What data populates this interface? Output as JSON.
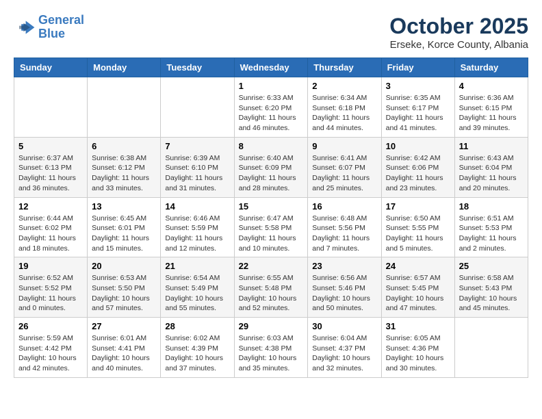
{
  "logo": {
    "line1": "General",
    "line2": "Blue"
  },
  "title": "October 2025",
  "subtitle": "Erseke, Korce County, Albania",
  "weekdays": [
    "Sunday",
    "Monday",
    "Tuesday",
    "Wednesday",
    "Thursday",
    "Friday",
    "Saturday"
  ],
  "weeks": [
    [
      {
        "day": "",
        "info": ""
      },
      {
        "day": "",
        "info": ""
      },
      {
        "day": "",
        "info": ""
      },
      {
        "day": "1",
        "info": "Sunrise: 6:33 AM\nSunset: 6:20 PM\nDaylight: 11 hours and 46 minutes."
      },
      {
        "day": "2",
        "info": "Sunrise: 6:34 AM\nSunset: 6:18 PM\nDaylight: 11 hours and 44 minutes."
      },
      {
        "day": "3",
        "info": "Sunrise: 6:35 AM\nSunset: 6:17 PM\nDaylight: 11 hours and 41 minutes."
      },
      {
        "day": "4",
        "info": "Sunrise: 6:36 AM\nSunset: 6:15 PM\nDaylight: 11 hours and 39 minutes."
      }
    ],
    [
      {
        "day": "5",
        "info": "Sunrise: 6:37 AM\nSunset: 6:13 PM\nDaylight: 11 hours and 36 minutes."
      },
      {
        "day": "6",
        "info": "Sunrise: 6:38 AM\nSunset: 6:12 PM\nDaylight: 11 hours and 33 minutes."
      },
      {
        "day": "7",
        "info": "Sunrise: 6:39 AM\nSunset: 6:10 PM\nDaylight: 11 hours and 31 minutes."
      },
      {
        "day": "8",
        "info": "Sunrise: 6:40 AM\nSunset: 6:09 PM\nDaylight: 11 hours and 28 minutes."
      },
      {
        "day": "9",
        "info": "Sunrise: 6:41 AM\nSunset: 6:07 PM\nDaylight: 11 hours and 25 minutes."
      },
      {
        "day": "10",
        "info": "Sunrise: 6:42 AM\nSunset: 6:06 PM\nDaylight: 11 hours and 23 minutes."
      },
      {
        "day": "11",
        "info": "Sunrise: 6:43 AM\nSunset: 6:04 PM\nDaylight: 11 hours and 20 minutes."
      }
    ],
    [
      {
        "day": "12",
        "info": "Sunrise: 6:44 AM\nSunset: 6:02 PM\nDaylight: 11 hours and 18 minutes."
      },
      {
        "day": "13",
        "info": "Sunrise: 6:45 AM\nSunset: 6:01 PM\nDaylight: 11 hours and 15 minutes."
      },
      {
        "day": "14",
        "info": "Sunrise: 6:46 AM\nSunset: 5:59 PM\nDaylight: 11 hours and 12 minutes."
      },
      {
        "day": "15",
        "info": "Sunrise: 6:47 AM\nSunset: 5:58 PM\nDaylight: 11 hours and 10 minutes."
      },
      {
        "day": "16",
        "info": "Sunrise: 6:48 AM\nSunset: 5:56 PM\nDaylight: 11 hours and 7 minutes."
      },
      {
        "day": "17",
        "info": "Sunrise: 6:50 AM\nSunset: 5:55 PM\nDaylight: 11 hours and 5 minutes."
      },
      {
        "day": "18",
        "info": "Sunrise: 6:51 AM\nSunset: 5:53 PM\nDaylight: 11 hours and 2 minutes."
      }
    ],
    [
      {
        "day": "19",
        "info": "Sunrise: 6:52 AM\nSunset: 5:52 PM\nDaylight: 11 hours and 0 minutes."
      },
      {
        "day": "20",
        "info": "Sunrise: 6:53 AM\nSunset: 5:50 PM\nDaylight: 10 hours and 57 minutes."
      },
      {
        "day": "21",
        "info": "Sunrise: 6:54 AM\nSunset: 5:49 PM\nDaylight: 10 hours and 55 minutes."
      },
      {
        "day": "22",
        "info": "Sunrise: 6:55 AM\nSunset: 5:48 PM\nDaylight: 10 hours and 52 minutes."
      },
      {
        "day": "23",
        "info": "Sunrise: 6:56 AM\nSunset: 5:46 PM\nDaylight: 10 hours and 50 minutes."
      },
      {
        "day": "24",
        "info": "Sunrise: 6:57 AM\nSunset: 5:45 PM\nDaylight: 10 hours and 47 minutes."
      },
      {
        "day": "25",
        "info": "Sunrise: 6:58 AM\nSunset: 5:43 PM\nDaylight: 10 hours and 45 minutes."
      }
    ],
    [
      {
        "day": "26",
        "info": "Sunrise: 5:59 AM\nSunset: 4:42 PM\nDaylight: 10 hours and 42 minutes."
      },
      {
        "day": "27",
        "info": "Sunrise: 6:01 AM\nSunset: 4:41 PM\nDaylight: 10 hours and 40 minutes."
      },
      {
        "day": "28",
        "info": "Sunrise: 6:02 AM\nSunset: 4:39 PM\nDaylight: 10 hours and 37 minutes."
      },
      {
        "day": "29",
        "info": "Sunrise: 6:03 AM\nSunset: 4:38 PM\nDaylight: 10 hours and 35 minutes."
      },
      {
        "day": "30",
        "info": "Sunrise: 6:04 AM\nSunset: 4:37 PM\nDaylight: 10 hours and 32 minutes."
      },
      {
        "day": "31",
        "info": "Sunrise: 6:05 AM\nSunset: 4:36 PM\nDaylight: 10 hours and 30 minutes."
      },
      {
        "day": "",
        "info": ""
      }
    ]
  ]
}
